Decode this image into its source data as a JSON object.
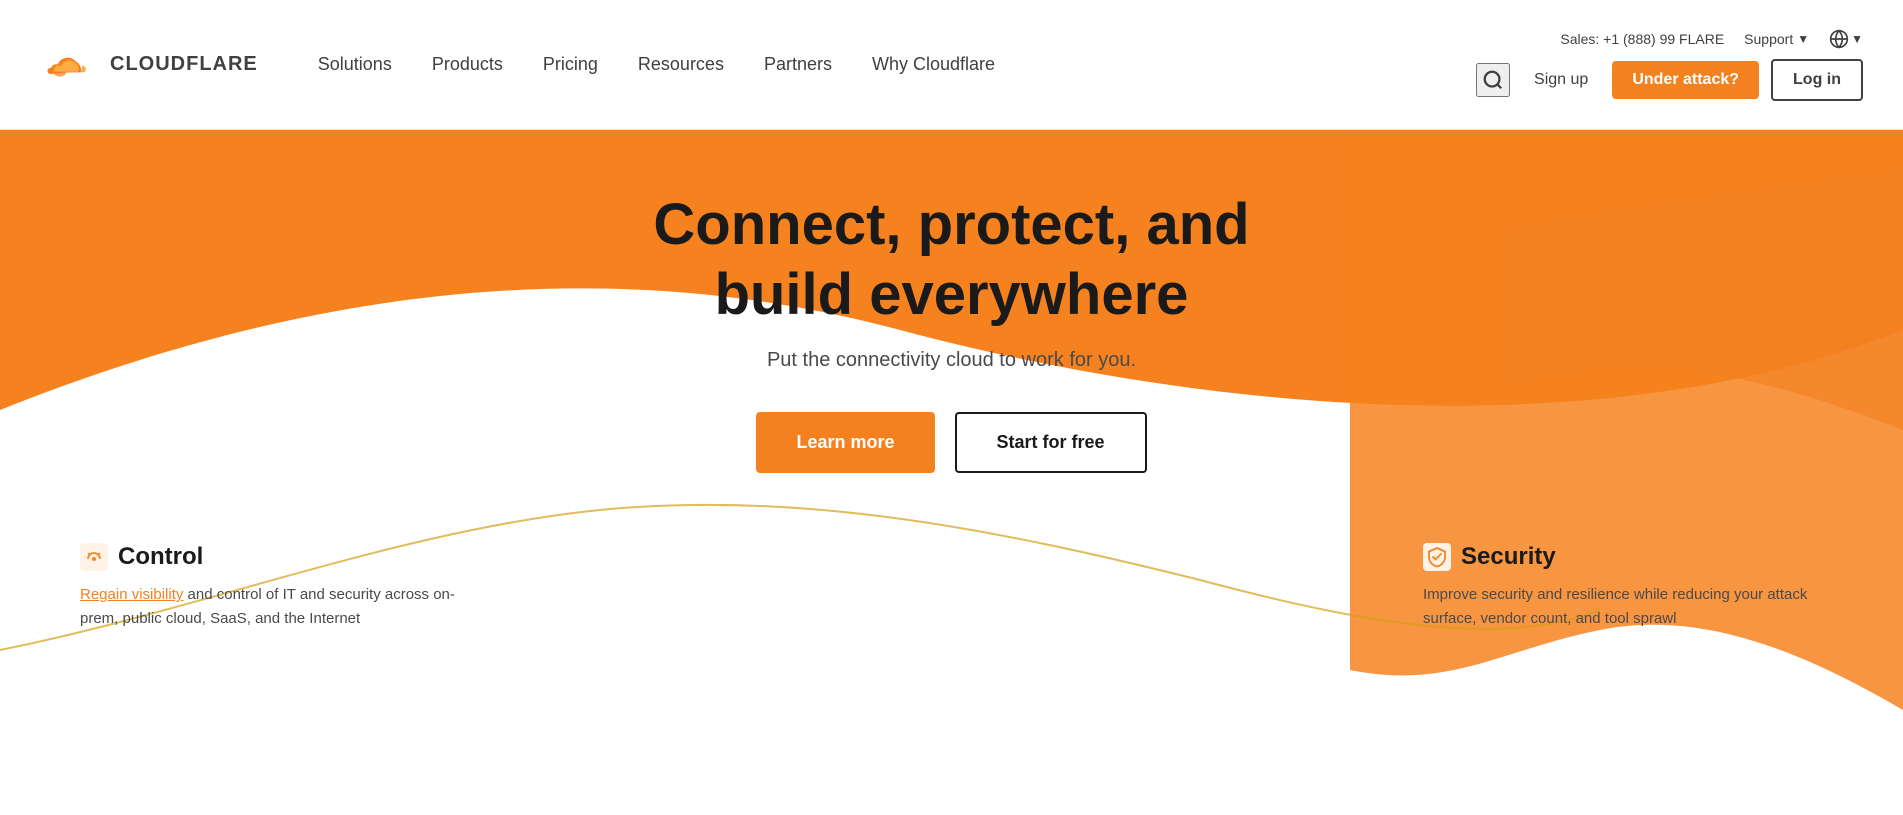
{
  "header": {
    "logo_text": "CLOUDFLARE",
    "sales_text": "Sales: +1 (888) 99 FLARE",
    "support_label": "Support",
    "nav_items": [
      {
        "label": "Solutions",
        "id": "solutions"
      },
      {
        "label": "Products",
        "id": "products"
      },
      {
        "label": "Pricing",
        "id": "pricing"
      },
      {
        "label": "Resources",
        "id": "resources"
      },
      {
        "label": "Partners",
        "id": "partners"
      },
      {
        "label": "Why Cloudflare",
        "id": "why-cloudflare"
      }
    ],
    "signup_label": "Sign up",
    "under_attack_label": "Under attack?",
    "login_label": "Log in"
  },
  "hero": {
    "title_line1": "Connect, protect, and",
    "title_line2": "build everywhere",
    "subtitle": "Put the connectivity cloud to work for you.",
    "learn_more_label": "Learn more",
    "start_free_label": "Start for free"
  },
  "features": [
    {
      "id": "control",
      "icon": "control-icon",
      "title": "Control",
      "description_parts": [
        {
          "text": "Regain visibility",
          "underline": true
        },
        {
          "text": " and control of IT and security across on-prem, public cloud, SaaS, and the Internet",
          "underline": false
        }
      ],
      "full_desc": "Regain visibility and control of IT and security across on-prem, public cloud, SaaS, and the Internet"
    },
    {
      "id": "security",
      "icon": "security-icon",
      "title": "Security",
      "full_desc": "Improve security and resilience while reducing your attack surface, vendor count, and tool sprawl"
    }
  ],
  "colors": {
    "orange": "#f48120",
    "dark": "#1a1a1a",
    "text_gray": "#4a4a4a",
    "light_gray": "#e8e8e8"
  }
}
